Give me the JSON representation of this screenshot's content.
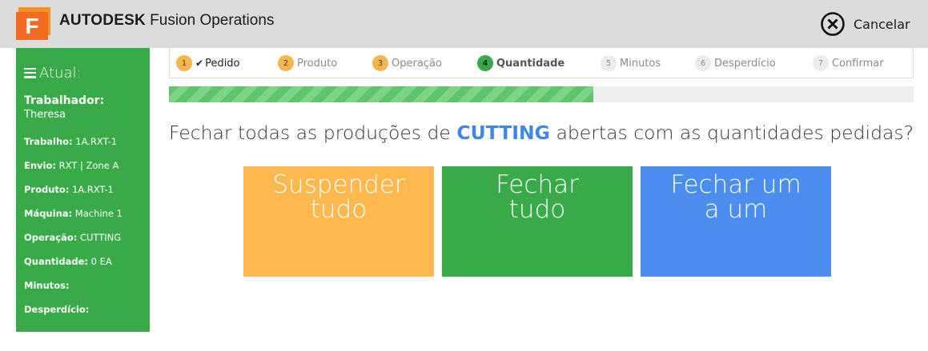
{
  "header": {
    "logo_letter": "F",
    "brand_strong": "AUTODESK",
    "brand_rest": " Fusion Operations",
    "cancel_label": "Cancelar"
  },
  "sidebar": {
    "heading": "Atual:",
    "worker_label": "Trabalhador:",
    "worker_value": "Theresa",
    "rows": [
      {
        "key": "Trabalho:",
        "value": " 1A.RXT-1"
      },
      {
        "key": "Envio:",
        "value": " RXT | Zone A"
      },
      {
        "key": "Produto:",
        "value": " 1A.RXT-1"
      },
      {
        "key": "Máquina:",
        "value": " Machine 1"
      },
      {
        "key": "Operação:",
        "value": " CUTTING"
      },
      {
        "key": "Quantidade:",
        "value": " 0 EA"
      },
      {
        "key": "Minutos:",
        "value": ""
      },
      {
        "key": "Desperdício:",
        "value": ""
      }
    ]
  },
  "steps": [
    {
      "num": "1",
      "label": "Pedido",
      "state": "done"
    },
    {
      "num": "2",
      "label": "Produto",
      "state": "pending-orange"
    },
    {
      "num": "3",
      "label": "Operação",
      "state": "pending-orange"
    },
    {
      "num": "4",
      "label": "Quantidade",
      "state": "active"
    },
    {
      "num": "5",
      "label": "Minutos",
      "state": "upcoming"
    },
    {
      "num": "6",
      "label": "Desperdício",
      "state": "upcoming"
    },
    {
      "num": "7",
      "label": "Confirmar",
      "state": "upcoming"
    }
  ],
  "progress": {
    "fraction": 0.57
  },
  "question": {
    "before": "Fechar todas as produções de ",
    "highlight": "CUTTING",
    "after": " abertas com as quantidades pedidas?"
  },
  "actions": {
    "suspend_label": "Suspender tudo",
    "close_all_label": "Fechar tudo",
    "close_one_label": "Fechar um a um"
  },
  "colors": {
    "accent_green": "#39aa48",
    "accent_orange": "#ffb84d",
    "accent_blue": "#4b8ef0",
    "highlight_blue": "#3f87e6",
    "logo_orange": "#f26b21"
  }
}
